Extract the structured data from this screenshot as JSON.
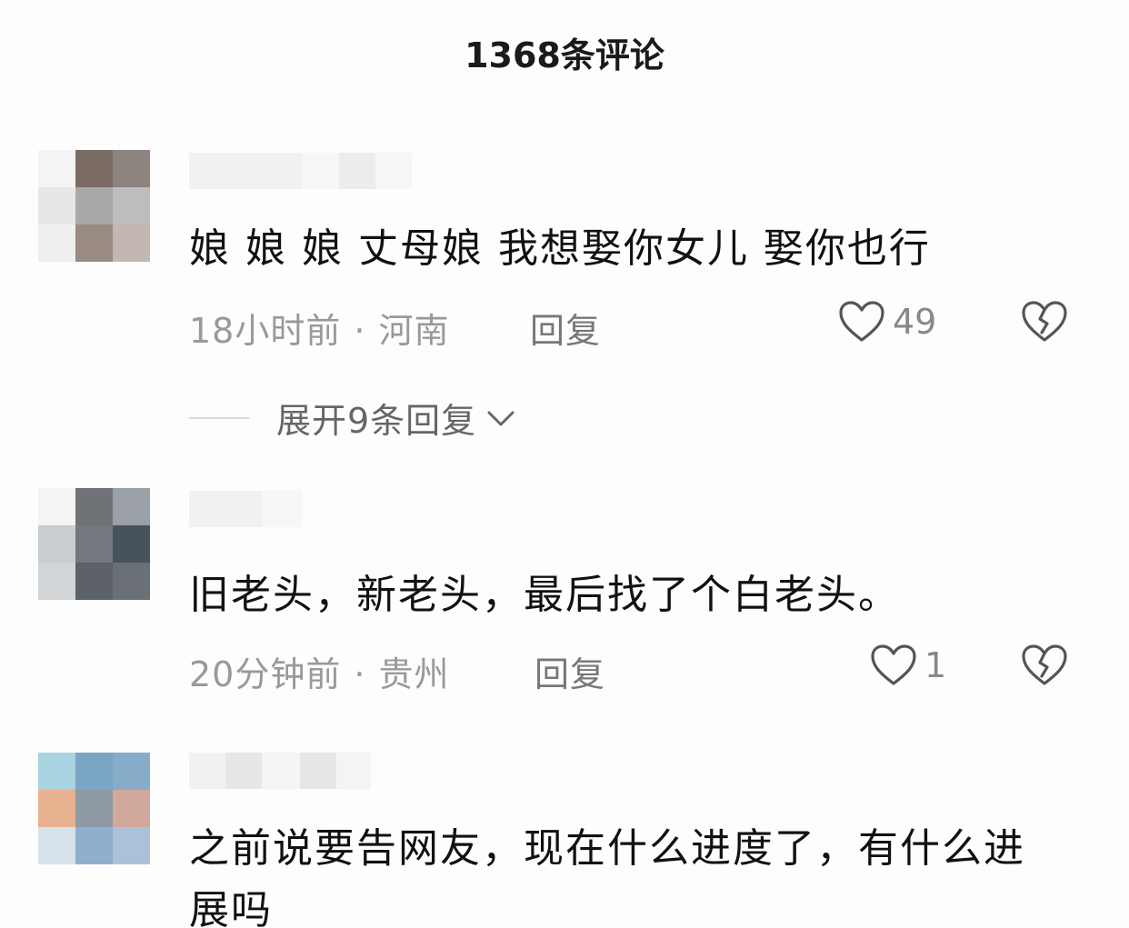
{
  "header": {
    "title": "1368条评论"
  },
  "comments": [
    {
      "text": "娘 娘 娘 丈母娘 我想娶你女儿  娶你也行",
      "time": "18小时前",
      "location": "河南",
      "reply_label": "回复",
      "likes": "49",
      "expand_label": "展开9条回复"
    },
    {
      "text": "旧老头，新老头，最后找了个白老头。",
      "time": "20分钟前",
      "location": "贵州",
      "reply_label": "回复",
      "likes": "1"
    },
    {
      "text": "之前说要告网友，现在什么进度了，有什么进展吗"
    }
  ],
  "icons": {
    "like": "heart-outline-icon",
    "dislike": "broken-heart-icon",
    "expand": "chevron-down-icon"
  },
  "colors": {
    "text": "#111111",
    "meta": "#999999",
    "icon": "#555555"
  }
}
